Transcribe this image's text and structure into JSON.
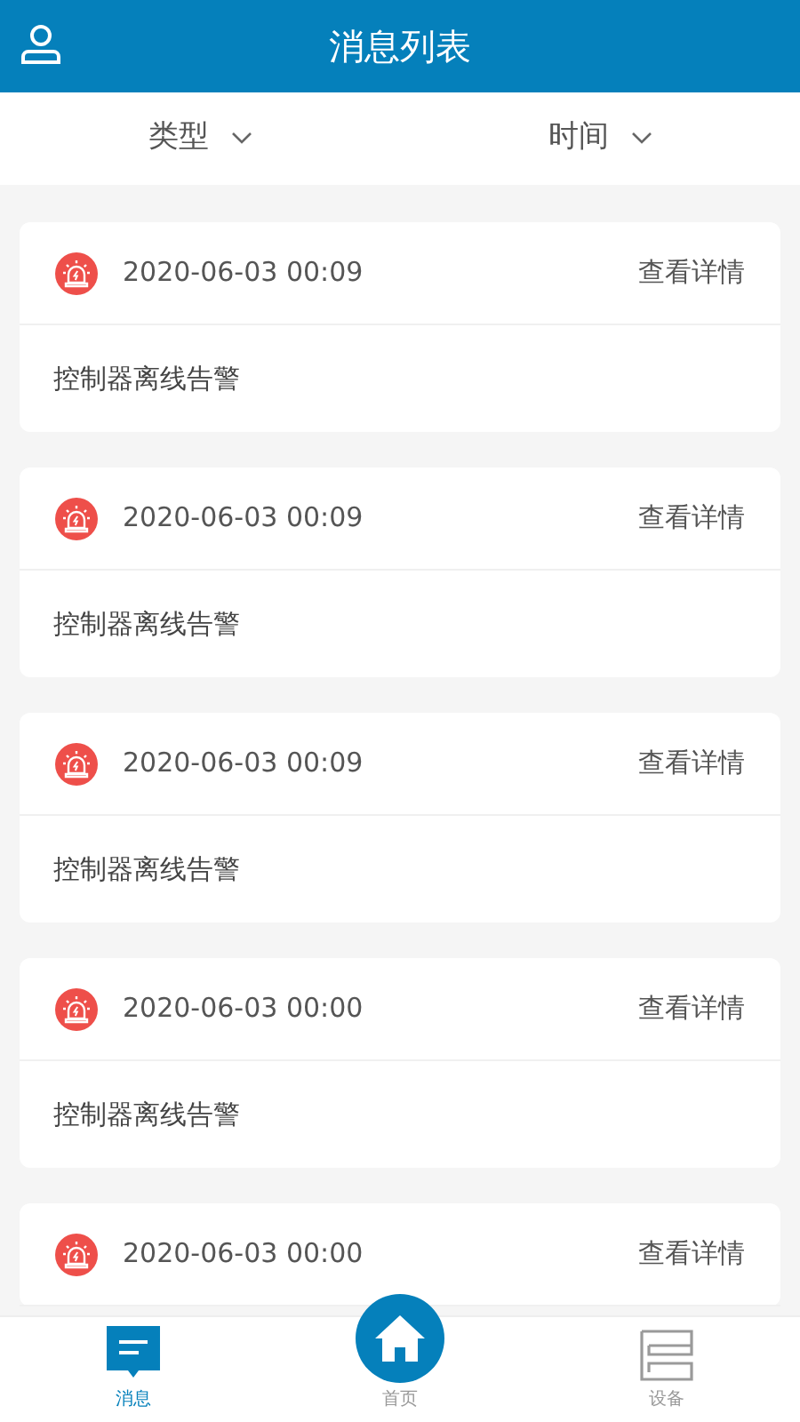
{
  "header": {
    "title": "消息列表"
  },
  "filters": [
    {
      "label": "类型"
    },
    {
      "label": "时间"
    }
  ],
  "messages": [
    {
      "time": "2020-06-03 00:09",
      "action": "查看详情",
      "text": "控制器离线告警"
    },
    {
      "time": "2020-06-03 00:09",
      "action": "查看详情",
      "text": "控制器离线告警"
    },
    {
      "time": "2020-06-03 00:09",
      "action": "查看详情",
      "text": "控制器离线告警"
    },
    {
      "time": "2020-06-03 00:00",
      "action": "查看详情",
      "text": "控制器离线告警"
    },
    {
      "time": "2020-06-03 00:00",
      "action": "查看详情"
    }
  ],
  "nav": [
    {
      "kind": "message",
      "label": "消息",
      "selected": true
    },
    {
      "kind": "home",
      "label": "首页",
      "selected": false
    },
    {
      "kind": "device",
      "label": "设备",
      "selected": false
    }
  ]
}
